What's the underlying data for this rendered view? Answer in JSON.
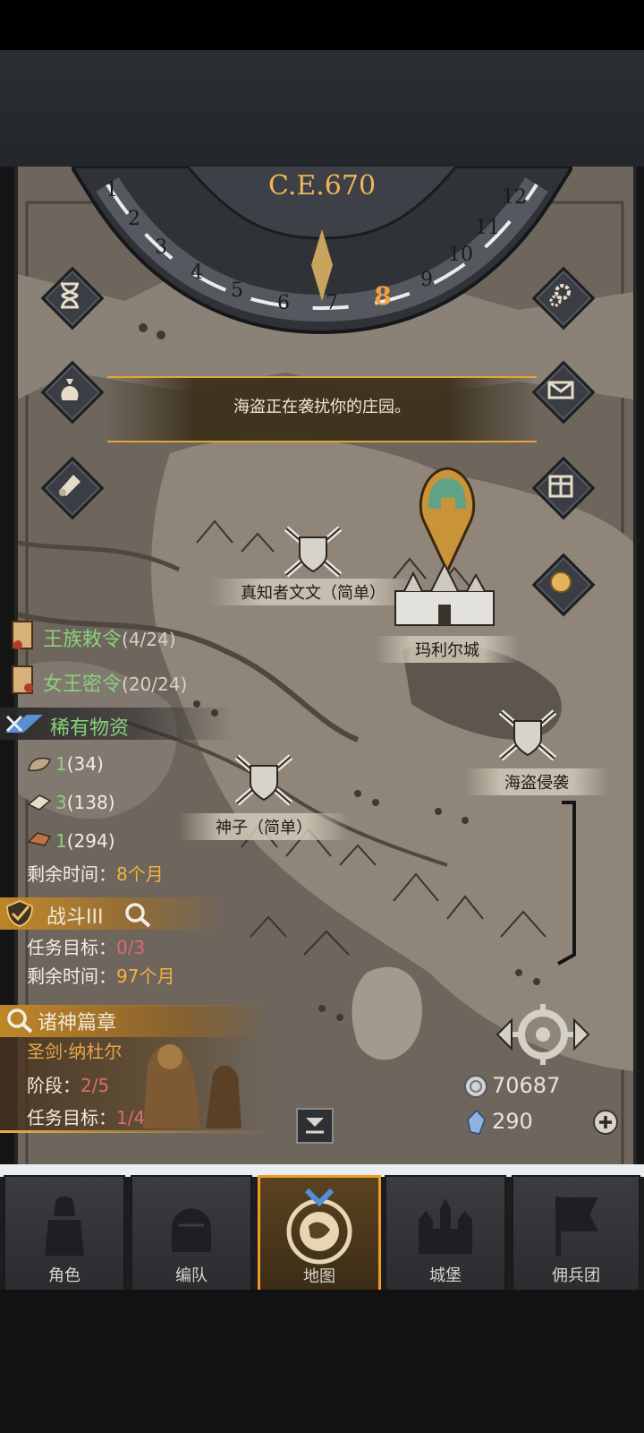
{
  "calendar": {
    "year": "C.E.670",
    "months": [
      "1",
      "2",
      "3",
      "4",
      "5",
      "6",
      "7",
      "8",
      "9",
      "10",
      "11",
      "12"
    ],
    "current_month": "8"
  },
  "left_buttons": [
    "hourglass-icon",
    "money-bag-icon",
    "scroll-icon"
  ],
  "right_buttons": [
    "gear-icon",
    "mail-icon",
    "grid-icon",
    "coin-icon"
  ],
  "banner": {
    "text": "海盗正在袭扰你的庄园。"
  },
  "map_markers": {
    "battle1": "真知者文文（简单）",
    "city": "玛利尔城",
    "battle2": "海盗侵袭",
    "battle3": "神子（简单）"
  },
  "quests": {
    "royal_decree": {
      "label": "王族敕令",
      "count": "(4/24)"
    },
    "queen_order": {
      "label": "女王密令",
      "count": "(20/24)"
    },
    "rare": {
      "title": "稀有物资",
      "items": [
        {
          "icon": "hide-icon",
          "qty": "1",
          "total": "(34)"
        },
        {
          "icon": "cloth-icon",
          "qty": "3",
          "total": "(138)"
        },
        {
          "icon": "leather-icon",
          "qty": "1",
          "total": "(294)"
        }
      ],
      "time_label": "剩余时间：",
      "time_value": "8个月"
    },
    "battle": {
      "title": "战斗III",
      "target_label": "任务目标：",
      "target_value": "0/3",
      "time_label": "剩余时间：",
      "time_value": "97个月"
    },
    "gods": {
      "title": "诸神篇章",
      "subtitle": "圣剑·纳杜尔",
      "stage_label": "阶段：",
      "stage_value": "2/5",
      "target_label": "任务目标：",
      "target_value": "1/4"
    }
  },
  "currency": {
    "silver": "70687",
    "crystal": "290"
  },
  "nav": [
    {
      "label": "角色",
      "icon": "knight-icon"
    },
    {
      "label": "编队",
      "icon": "helmet-icon"
    },
    {
      "label": "地图",
      "icon": "map-icon"
    },
    {
      "label": "城堡",
      "icon": "castle-icon"
    },
    {
      "label": "佣兵团",
      "icon": "banner-icon"
    }
  ],
  "colors": {
    "accent": "#f09a2a",
    "gold_text": "#f0b55a",
    "green_text": "#8bd07c"
  }
}
